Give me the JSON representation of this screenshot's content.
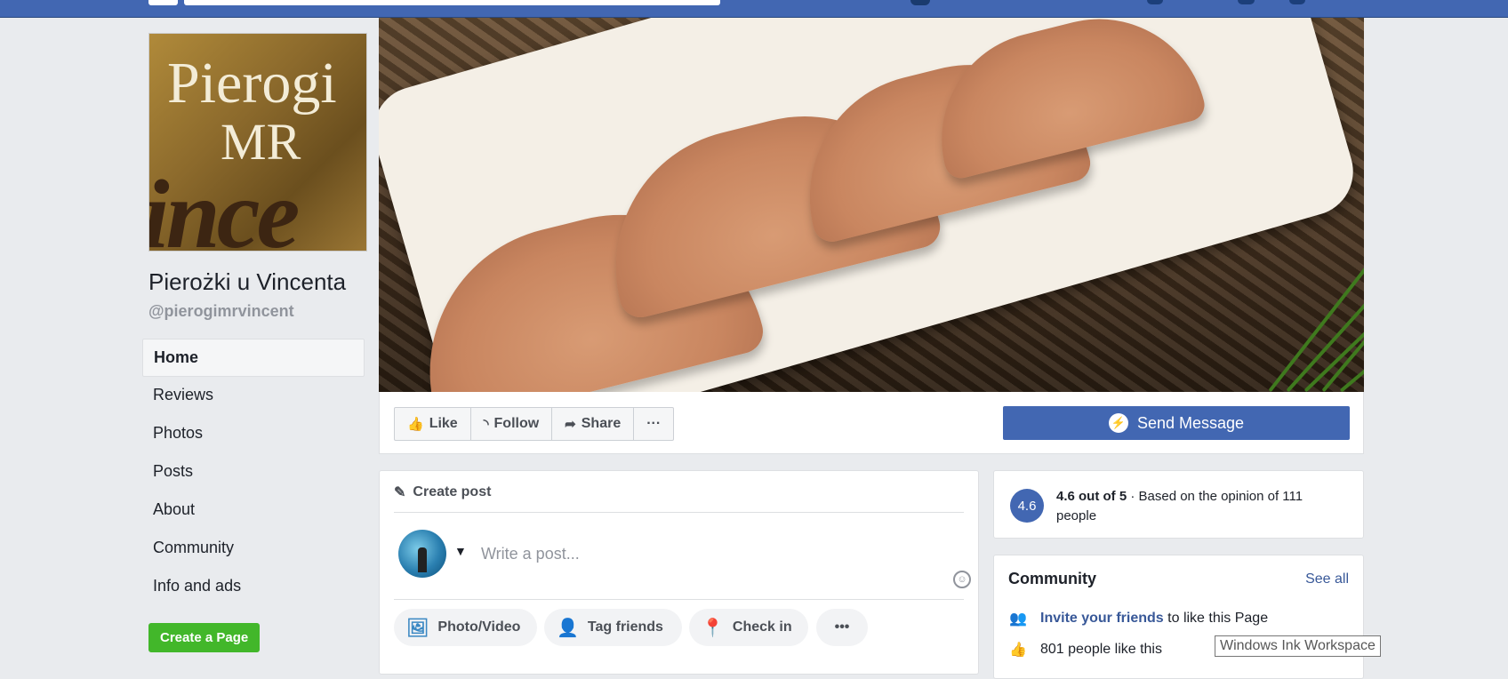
{
  "page": {
    "name": "Pierożki u Vincenta",
    "handle": "@pierogimrvincent",
    "logo": {
      "line1": "Pierogi",
      "line2": "MR",
      "script": "ince"
    }
  },
  "nav": {
    "items": [
      {
        "label": "Home",
        "active": true
      },
      {
        "label": "Reviews"
      },
      {
        "label": "Photos"
      },
      {
        "label": "Posts"
      },
      {
        "label": "About"
      },
      {
        "label": "Community"
      },
      {
        "label": "Info and ads"
      }
    ],
    "create_page": "Create a Page"
  },
  "actions": {
    "like": "Like",
    "follow": "Follow",
    "share": "Share",
    "more": "···",
    "send_message": "Send Message"
  },
  "composer": {
    "title": "Create post",
    "placeholder": "Write a post...",
    "buttons": {
      "photo": "Photo/Video",
      "tag": "Tag friends",
      "checkin": "Check in",
      "more": "•••"
    }
  },
  "rating": {
    "badge": "4.6",
    "score": "4.6 out of 5",
    "text": " · Based on the opinion of 111 people"
  },
  "community": {
    "title": "Community",
    "see_all": "See all",
    "invite_link": "Invite your friends",
    "invite_rest": " to like this Page",
    "likes": "801 people like this"
  },
  "tooltip": "Windows Ink Workspace",
  "colors": {
    "brand": "#4267b2",
    "create_page": "#42b72a",
    "link": "#385898"
  }
}
